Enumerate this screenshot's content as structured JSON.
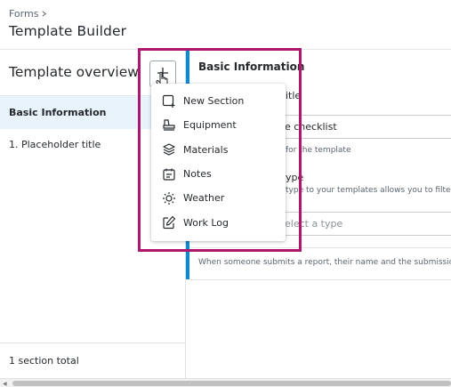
{
  "header": {
    "breadcrumb": "Forms",
    "title": "Template Builder"
  },
  "left_panel": {
    "title": "Template overview",
    "add_button_icon": "plus-icon",
    "sections": [
      {
        "label": "Basic Information",
        "selected": true
      },
      {
        "label": "1. Placeholder title",
        "selected": false
      }
    ],
    "footer": "1 section total"
  },
  "right_panel": {
    "title": "Basic Information",
    "title_field_label_fragment": "itle",
    "title_input_value_fragment": "e checklist",
    "title_help_fragment": "for the template",
    "type_label_fragment": "ype",
    "type_help_fragment": "type to your templates allows you to filter t",
    "type_placeholder_fragment": "elect a type",
    "submission_note": "When someone submits a report, their name and the submission d"
  },
  "menu": {
    "items": [
      {
        "label": "New Section",
        "icon": "new-section-icon"
      },
      {
        "label": "Equipment",
        "icon": "equipment-icon"
      },
      {
        "label": "Materials",
        "icon": "materials-icon"
      },
      {
        "label": "Notes",
        "icon": "notes-icon"
      },
      {
        "label": "Weather",
        "icon": "weather-icon"
      },
      {
        "label": "Work Log",
        "icon": "work-log-icon"
      }
    ]
  },
  "colors": {
    "accent_blue": "#0a8bd6",
    "selected_bg": "#e8f3fb",
    "highlight_border": "#b0166d"
  }
}
